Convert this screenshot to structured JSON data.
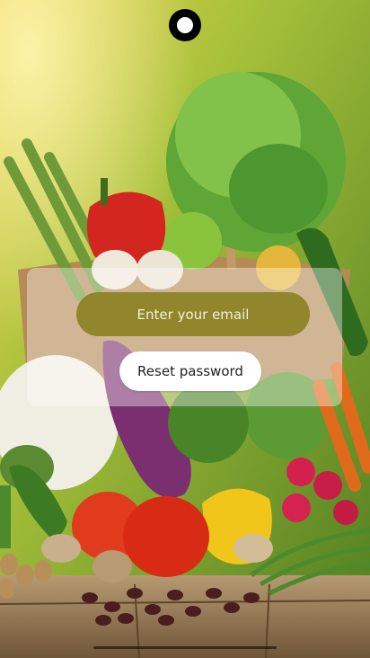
{
  "form": {
    "email_placeholder": "Enter your email",
    "reset_label": "Reset password"
  },
  "colors": {
    "email_field_bg": "#867e1a",
    "button_bg": "#ffffff",
    "card_overlay": "rgba(255,255,255,0.38)"
  },
  "background": {
    "image": "vegetable-basket-photo"
  }
}
